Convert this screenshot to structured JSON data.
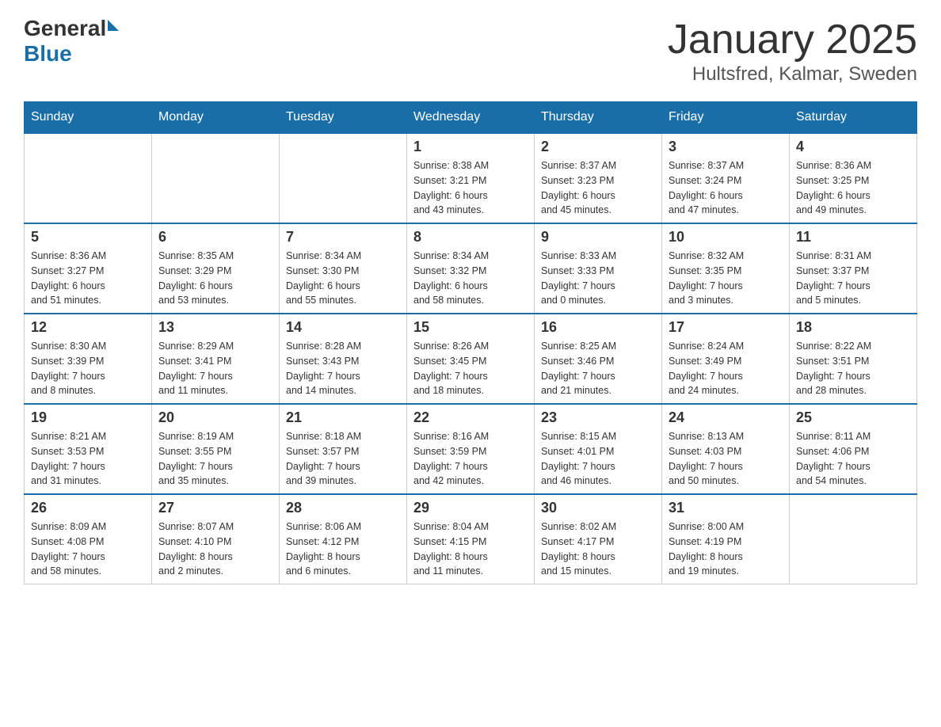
{
  "header": {
    "logo_general": "General",
    "logo_blue": "Blue",
    "month_title": "January 2025",
    "location": "Hultsfred, Kalmar, Sweden"
  },
  "days_of_week": [
    "Sunday",
    "Monday",
    "Tuesday",
    "Wednesday",
    "Thursday",
    "Friday",
    "Saturday"
  ],
  "weeks": [
    [
      {
        "day": "",
        "info": ""
      },
      {
        "day": "",
        "info": ""
      },
      {
        "day": "",
        "info": ""
      },
      {
        "day": "1",
        "info": "Sunrise: 8:38 AM\nSunset: 3:21 PM\nDaylight: 6 hours\nand 43 minutes."
      },
      {
        "day": "2",
        "info": "Sunrise: 8:37 AM\nSunset: 3:23 PM\nDaylight: 6 hours\nand 45 minutes."
      },
      {
        "day": "3",
        "info": "Sunrise: 8:37 AM\nSunset: 3:24 PM\nDaylight: 6 hours\nand 47 minutes."
      },
      {
        "day": "4",
        "info": "Sunrise: 8:36 AM\nSunset: 3:25 PM\nDaylight: 6 hours\nand 49 minutes."
      }
    ],
    [
      {
        "day": "5",
        "info": "Sunrise: 8:36 AM\nSunset: 3:27 PM\nDaylight: 6 hours\nand 51 minutes."
      },
      {
        "day": "6",
        "info": "Sunrise: 8:35 AM\nSunset: 3:29 PM\nDaylight: 6 hours\nand 53 minutes."
      },
      {
        "day": "7",
        "info": "Sunrise: 8:34 AM\nSunset: 3:30 PM\nDaylight: 6 hours\nand 55 minutes."
      },
      {
        "day": "8",
        "info": "Sunrise: 8:34 AM\nSunset: 3:32 PM\nDaylight: 6 hours\nand 58 minutes."
      },
      {
        "day": "9",
        "info": "Sunrise: 8:33 AM\nSunset: 3:33 PM\nDaylight: 7 hours\nand 0 minutes."
      },
      {
        "day": "10",
        "info": "Sunrise: 8:32 AM\nSunset: 3:35 PM\nDaylight: 7 hours\nand 3 minutes."
      },
      {
        "day": "11",
        "info": "Sunrise: 8:31 AM\nSunset: 3:37 PM\nDaylight: 7 hours\nand 5 minutes."
      }
    ],
    [
      {
        "day": "12",
        "info": "Sunrise: 8:30 AM\nSunset: 3:39 PM\nDaylight: 7 hours\nand 8 minutes."
      },
      {
        "day": "13",
        "info": "Sunrise: 8:29 AM\nSunset: 3:41 PM\nDaylight: 7 hours\nand 11 minutes."
      },
      {
        "day": "14",
        "info": "Sunrise: 8:28 AM\nSunset: 3:43 PM\nDaylight: 7 hours\nand 14 minutes."
      },
      {
        "day": "15",
        "info": "Sunrise: 8:26 AM\nSunset: 3:45 PM\nDaylight: 7 hours\nand 18 minutes."
      },
      {
        "day": "16",
        "info": "Sunrise: 8:25 AM\nSunset: 3:46 PM\nDaylight: 7 hours\nand 21 minutes."
      },
      {
        "day": "17",
        "info": "Sunrise: 8:24 AM\nSunset: 3:49 PM\nDaylight: 7 hours\nand 24 minutes."
      },
      {
        "day": "18",
        "info": "Sunrise: 8:22 AM\nSunset: 3:51 PM\nDaylight: 7 hours\nand 28 minutes."
      }
    ],
    [
      {
        "day": "19",
        "info": "Sunrise: 8:21 AM\nSunset: 3:53 PM\nDaylight: 7 hours\nand 31 minutes."
      },
      {
        "day": "20",
        "info": "Sunrise: 8:19 AM\nSunset: 3:55 PM\nDaylight: 7 hours\nand 35 minutes."
      },
      {
        "day": "21",
        "info": "Sunrise: 8:18 AM\nSunset: 3:57 PM\nDaylight: 7 hours\nand 39 minutes."
      },
      {
        "day": "22",
        "info": "Sunrise: 8:16 AM\nSunset: 3:59 PM\nDaylight: 7 hours\nand 42 minutes."
      },
      {
        "day": "23",
        "info": "Sunrise: 8:15 AM\nSunset: 4:01 PM\nDaylight: 7 hours\nand 46 minutes."
      },
      {
        "day": "24",
        "info": "Sunrise: 8:13 AM\nSunset: 4:03 PM\nDaylight: 7 hours\nand 50 minutes."
      },
      {
        "day": "25",
        "info": "Sunrise: 8:11 AM\nSunset: 4:06 PM\nDaylight: 7 hours\nand 54 minutes."
      }
    ],
    [
      {
        "day": "26",
        "info": "Sunrise: 8:09 AM\nSunset: 4:08 PM\nDaylight: 7 hours\nand 58 minutes."
      },
      {
        "day": "27",
        "info": "Sunrise: 8:07 AM\nSunset: 4:10 PM\nDaylight: 8 hours\nand 2 minutes."
      },
      {
        "day": "28",
        "info": "Sunrise: 8:06 AM\nSunset: 4:12 PM\nDaylight: 8 hours\nand 6 minutes."
      },
      {
        "day": "29",
        "info": "Sunrise: 8:04 AM\nSunset: 4:15 PM\nDaylight: 8 hours\nand 11 minutes."
      },
      {
        "day": "30",
        "info": "Sunrise: 8:02 AM\nSunset: 4:17 PM\nDaylight: 8 hours\nand 15 minutes."
      },
      {
        "day": "31",
        "info": "Sunrise: 8:00 AM\nSunset: 4:19 PM\nDaylight: 8 hours\nand 19 minutes."
      },
      {
        "day": "",
        "info": ""
      }
    ]
  ]
}
